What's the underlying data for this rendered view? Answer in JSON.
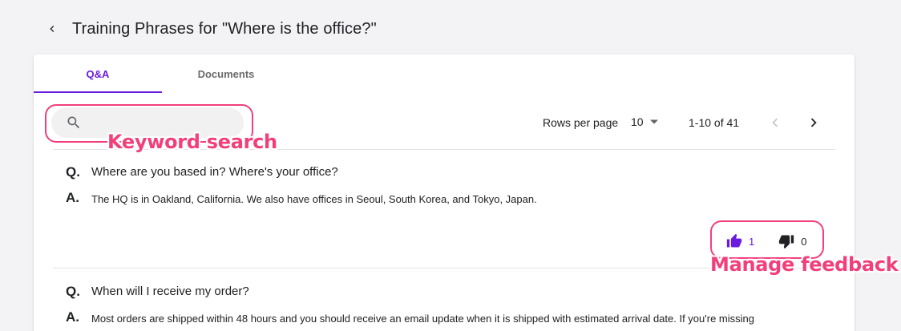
{
  "page": {
    "title": "Training Phrases for \"Where is the office?\""
  },
  "tabs": [
    {
      "label": "Q&A",
      "active": true
    },
    {
      "label": "Documents",
      "active": false
    }
  ],
  "search": {
    "placeholder": "",
    "value": ""
  },
  "pagination": {
    "rows_label": "Rows per page",
    "rows_value": "10",
    "range_text": "1-10 of 41"
  },
  "items": [
    {
      "q_prefix": "Q.",
      "question": "Where are you based in? Where's your office?",
      "a_prefix": "A.",
      "answer": "The HQ is in Oakland, California. We also have offices in Seoul, South Korea, and Tokyo, Japan.",
      "likes": "1",
      "dislikes": "0"
    },
    {
      "q_prefix": "Q.",
      "question": "When will I receive my order?",
      "a_prefix": "A.",
      "answer": "Most orders are shipped within 48 hours and you should receive an email update when it is shipped with estimated arrival date. If you're missing"
    }
  ],
  "annotations": {
    "keyword_search": "Keyword search",
    "manage_feedback": "Manage feedback"
  },
  "colors": {
    "accent": "#6a1be0",
    "annotation": "#f23f7a",
    "background": "#f3f3f5"
  },
  "icons": {
    "back": "chevron-left-icon",
    "search": "search-icon",
    "dropdown": "caret-down-icon",
    "prev": "chevron-left-icon",
    "next": "chevron-right-icon",
    "like": "thumb-up-icon",
    "dislike": "thumb-down-icon"
  }
}
